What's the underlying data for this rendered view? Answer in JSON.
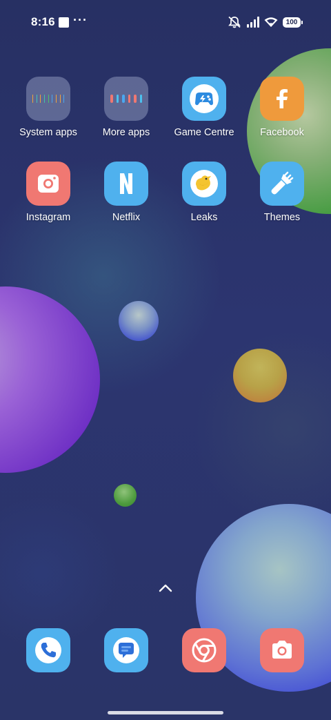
{
  "status_bar": {
    "time": "8:16",
    "more_indicator": "···",
    "battery_level": "100",
    "icons": [
      "notifications-muted-icon",
      "cellular-signal-icon",
      "wifi-icon",
      "battery-icon"
    ]
  },
  "home_grid": [
    {
      "label": "System apps",
      "icon": "folder-icon",
      "color": "#8a93c0"
    },
    {
      "label": "More apps",
      "icon": "folder-icon",
      "color": "#8a93c0"
    },
    {
      "label": "Game Centre",
      "icon": "gamepad-icon",
      "color": "#4fb1ee"
    },
    {
      "label": "Facebook",
      "icon": "facebook-icon",
      "color": "#ef9a3c"
    },
    {
      "label": "Instagram",
      "icon": "instagram-icon",
      "color": "#f07872"
    },
    {
      "label": "Netflix",
      "icon": "netflix-icon",
      "color": "#4fb1ee"
    },
    {
      "label": "Leaks",
      "icon": "bird-icon",
      "color": "#4fb1ee"
    },
    {
      "label": "Themes",
      "icon": "paintbrush-icon",
      "color": "#4fb1ee"
    }
  ],
  "dock": [
    {
      "icon": "phone-icon",
      "color": "#4fb1ee"
    },
    {
      "icon": "messages-icon",
      "color": "#4fb1ee"
    },
    {
      "icon": "chrome-icon",
      "color": "#f07872"
    },
    {
      "icon": "camera-icon",
      "color": "#f07872"
    }
  ],
  "app_drawer_indicator": "chevron-up-icon"
}
